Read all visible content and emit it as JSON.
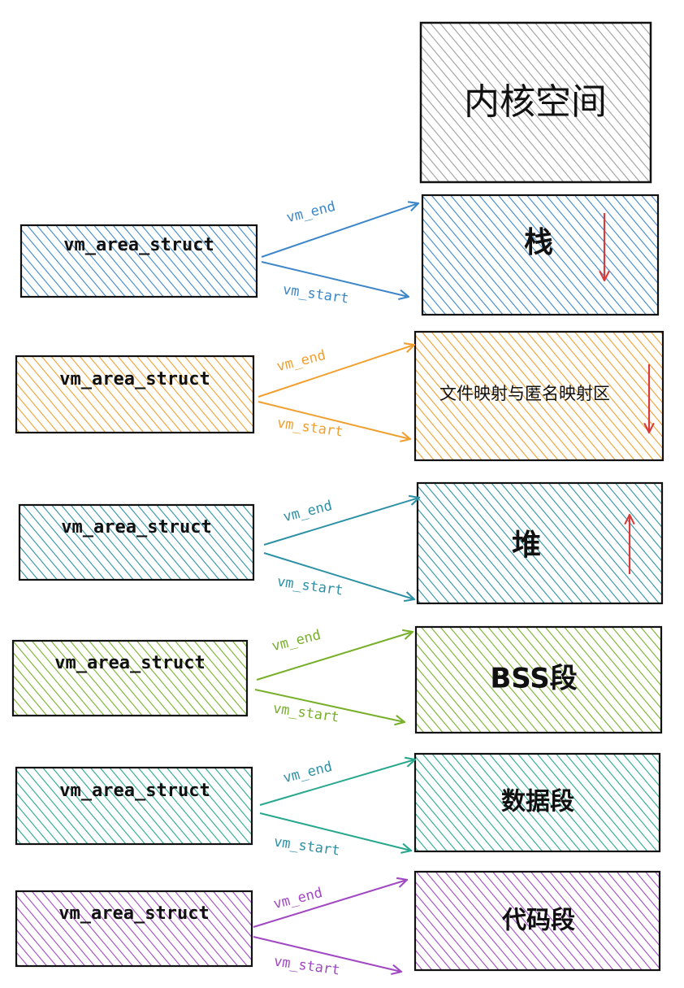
{
  "kernel": {
    "label": "内核空间",
    "color": "#9e9e9e"
  },
  "rows": [
    {
      "struct_label": "vm_area_struct",
      "end_label": "vm_end",
      "start_label": "vm_start",
      "region_label": "栈",
      "color": "#3d87c9",
      "growth": "down"
    },
    {
      "struct_label": "vm_area_struct",
      "end_label": "vm_end",
      "start_label": "vm_start",
      "region_label": "文件映射与匿名映射区",
      "color": "#f0a030",
      "growth": "down"
    },
    {
      "struct_label": "vm_area_struct",
      "end_label": "vm_end",
      "start_label": "vm_start",
      "region_label": "堆",
      "color": "#2e91a6",
      "growth": "up"
    },
    {
      "struct_label": "vm_area_struct",
      "end_label": "vm_end",
      "start_label": "vm_start",
      "region_label": "BSS段",
      "color": "#78b02b",
      "growth": "none"
    },
    {
      "struct_label": "vm_area_struct",
      "end_label": "vm_end",
      "start_label": "vm_start",
      "region_label": "数据段",
      "color": "#27a88e",
      "growth": "none"
    },
    {
      "struct_label": "vm_area_struct",
      "end_label": "vm_end",
      "start_label": "vm_start",
      "region_label": "代码段",
      "color": "#a149c2",
      "growth": "none"
    }
  ],
  "label_colors": [
    "#3d87c9",
    "#f0a030",
    "#2e91a6",
    "#78b02b",
    "#2e91a6",
    "#a149c2"
  ],
  "growth_arrow_color": "#d93a3a"
}
